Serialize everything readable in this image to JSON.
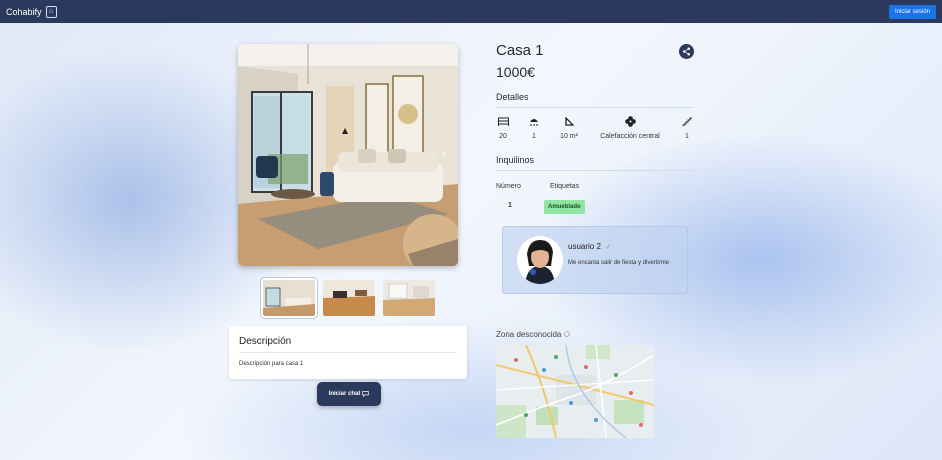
{
  "navbar": {
    "brand": "Cohabify",
    "login_label": "Iniciar sesión"
  },
  "property": {
    "title": "Casa 1",
    "price": "1000€",
    "details_heading": "Detalles",
    "details": [
      {
        "icon": "bed-icon",
        "value": "20"
      },
      {
        "icon": "shower-icon",
        "value": "1"
      },
      {
        "icon": "ruler-triangle-icon",
        "value": "10 m²"
      },
      {
        "icon": "heating-fan-icon",
        "value": "Calefacción central"
      },
      {
        "icon": "stairs-icon",
        "value": "1"
      }
    ],
    "tenants_heading": "Inquilinos",
    "tenants_table": {
      "col_number": "Número",
      "col_tags": "Etiquetas",
      "number": "1",
      "tag": "Amueblado"
    },
    "tenant": {
      "name": "usuario 2",
      "gender_symbol": "♂",
      "bio": "Me encanta salir de fiesta y divertirme"
    },
    "description_title": "Descripción",
    "description_text": "Descripción para casa 1",
    "chat_label": "Iniciar chat",
    "zone_label": "Zona desconocida"
  },
  "colors": {
    "navbar": "#2b3a5c",
    "primary_button": "#1a73e8",
    "badge": "#8ee6a0"
  }
}
